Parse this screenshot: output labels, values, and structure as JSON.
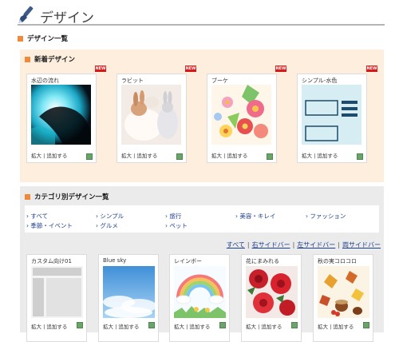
{
  "header": {
    "title": "デザイン"
  },
  "design_list": {
    "title": "デザイン一覧"
  },
  "new_designs": {
    "title": "新着デザイン",
    "badge": "NEW",
    "cards": [
      {
        "name": "水辺の流れ",
        "actions": "拡大 | 追加する"
      },
      {
        "name": "ラビット",
        "actions": "拡大 | 追加する"
      },
      {
        "name": "ブーケ",
        "actions": "拡大 | 追加する"
      },
      {
        "name": "シンプル-水色",
        "actions": "拡大 | 追加する"
      }
    ]
  },
  "category_designs": {
    "title": "カテゴリ別デザイン一覧",
    "categories": [
      "すべて",
      "シンプル",
      "旅行",
      "美容・キレイ",
      "ファッション",
      "季節・イベント",
      "グルメ",
      "ペット"
    ],
    "filters": [
      "すべて",
      "右サイドバー",
      "左サイドバー",
      "両サイドバー"
    ],
    "cards": [
      {
        "name": "カスタム向け01",
        "actions": "拡大 | 追加する"
      },
      {
        "name": "Blue sky",
        "actions": "拡大 | 追加する"
      },
      {
        "name": "レインボー",
        "actions": "拡大 | 追加する"
      },
      {
        "name": "花にまみれる",
        "actions": "拡大 | 追加する"
      },
      {
        "name": "秋の実コロコロ",
        "actions": "拡大 | 追加する"
      }
    ]
  },
  "colors": {
    "accent": "#f08a3a",
    "link": "#1b3d8f",
    "new_bg": "#fdeede",
    "category_bg": "#ebebeb",
    "badge": "#d81818"
  }
}
